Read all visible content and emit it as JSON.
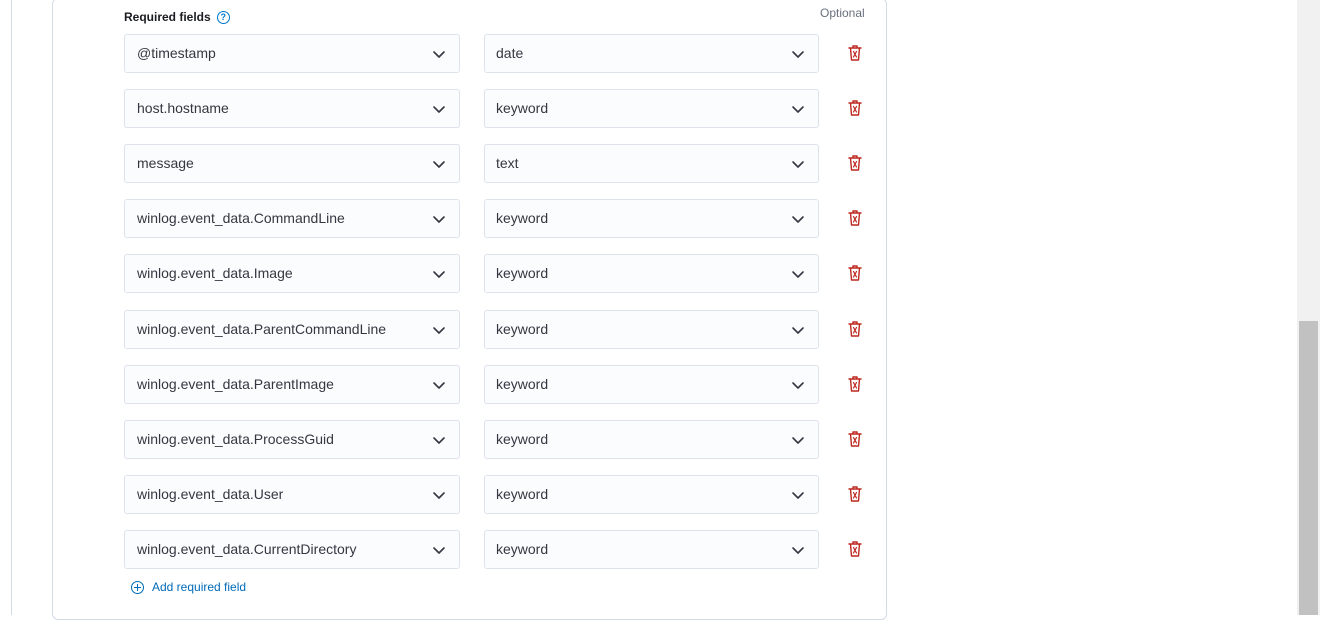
{
  "section": {
    "title": "Required fields",
    "optional_label": "Optional"
  },
  "icons": {
    "help": "question-circle-icon",
    "chevron": "chevron-down-icon",
    "delete": "trash-icon",
    "add": "plus-in-circle-icon"
  },
  "colors": {
    "link": "#006bb8",
    "danger": "#bd271e",
    "border": "#d3dae6",
    "field_bg": "#fbfcfd"
  },
  "fields": [
    {
      "name": "@timestamp",
      "type": "date"
    },
    {
      "name": "host.hostname",
      "type": "keyword"
    },
    {
      "name": "message",
      "type": "text"
    },
    {
      "name": "winlog.event_data.CommandLine",
      "type": "keyword"
    },
    {
      "name": "winlog.event_data.Image",
      "type": "keyword"
    },
    {
      "name": "winlog.event_data.ParentCommandLine",
      "type": "keyword"
    },
    {
      "name": "winlog.event_data.ParentImage",
      "type": "keyword"
    },
    {
      "name": "winlog.event_data.ProcessGuid",
      "type": "keyword"
    },
    {
      "name": "winlog.event_data.User",
      "type": "keyword"
    },
    {
      "name": "winlog.event_data.CurrentDirectory",
      "type": "keyword"
    }
  ],
  "add_button_label": "Add required field"
}
